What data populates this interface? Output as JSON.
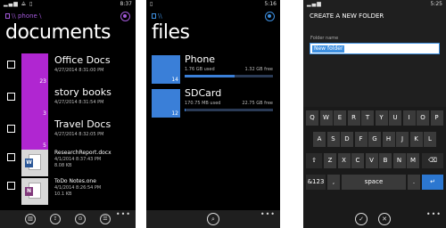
{
  "screen1": {
    "status": {
      "left": "▂▄▆ ⟁ ▯",
      "time": "8:37"
    },
    "breadcrumb": "\\\\ phone \\",
    "title": "documents",
    "folders": [
      {
        "name": "Office Docs",
        "date": "4/27/2014 8:31:00 PM",
        "count": "23"
      },
      {
        "name": "story books",
        "date": "4/27/2014 8:31:54 PM",
        "count": "3"
      },
      {
        "name": "Travel Docs",
        "date": "4/27/2014 8:32:05 PM",
        "count": "5"
      }
    ],
    "files": [
      {
        "name": "ResearchReport.docx",
        "date": "4/1/2014 8:37:43 PM",
        "size": "8.08 KB",
        "badge": "W",
        "badge_color": "#2b5797"
      },
      {
        "name": "ToDo Notes.one",
        "date": "4/1/2014 8:26:54 PM",
        "size": "10.1 KB",
        "badge": "N",
        "badge_color": "#80397b"
      }
    ],
    "appbar_icons": [
      "delete-icon",
      "share-icon",
      "pin-icon",
      "select-icon"
    ],
    "more": "•••"
  },
  "screen2": {
    "status": {
      "left": "▯",
      "time": "5:16"
    },
    "breadcrumb": "\\\\",
    "title": "files",
    "storage": [
      {
        "name": "Phone",
        "count": "14",
        "used": "1.76 GB used",
        "free": "1.32 GB free",
        "fill": 0.57
      },
      {
        "name": "SDCard",
        "count": "12",
        "used": "170.75 MB used",
        "free": "22.75 GB free",
        "fill": 0.01
      }
    ],
    "more": "•••"
  },
  "screen3": {
    "status": {
      "left": "▂▄▆",
      "time": "5:25"
    },
    "title": "CREATE A NEW FOLDER",
    "field_label": "Folder name",
    "field_value": "New folder",
    "keys_row1": [
      "Q",
      "W",
      "E",
      "R",
      "T",
      "Y",
      "U",
      "I",
      "O",
      "P"
    ],
    "keys_row2": [
      "A",
      "S",
      "D",
      "F",
      "G",
      "H",
      "J",
      "K",
      "L"
    ],
    "keys_row3": [
      "⇧",
      "Z",
      "X",
      "C",
      "V",
      "B",
      "N",
      "M",
      "⌫"
    ],
    "keys_row4": [
      "&123",
      ",",
      "space",
      ".",
      "↵"
    ],
    "more": "•••"
  }
}
